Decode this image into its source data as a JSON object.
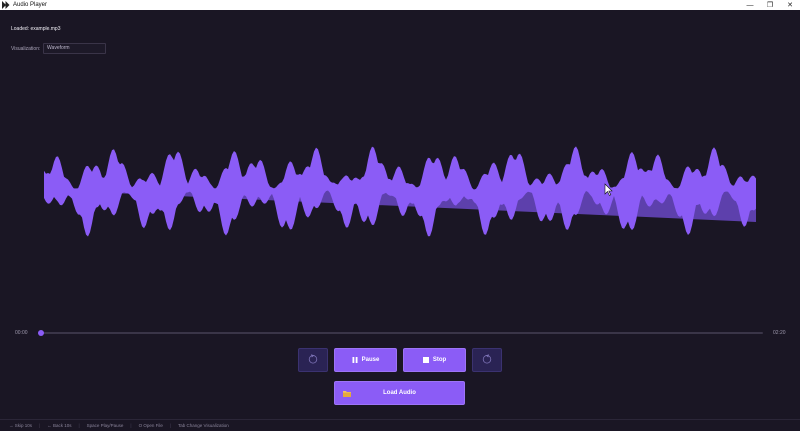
{
  "window": {
    "title": "Audio Player",
    "controls": {
      "minimize": "—",
      "maximize": "❐",
      "close": "✕"
    }
  },
  "status": {
    "loaded_text": "Loaded: example.mp3"
  },
  "visualization": {
    "label": "Visualization:",
    "selected": "Waveform"
  },
  "playback": {
    "current_time": "00:00",
    "total_time": "02:20",
    "progress": 0.0
  },
  "buttons": {
    "rewind_icon": "rewind-10-icon",
    "pause_label": "Pause",
    "stop_label": "Stop",
    "forward_icon": "forward-10-icon",
    "load_label": "Load Audio"
  },
  "shortcuts": [
    "→ Skip 10s",
    "← Back 10s",
    "Space Play/Pause",
    "O Open File",
    "Tab Change Visualization"
  ],
  "colors": {
    "accent": "#8b5cf6",
    "background": "#1a1624",
    "waveform_fill": "#8b5cf6"
  }
}
